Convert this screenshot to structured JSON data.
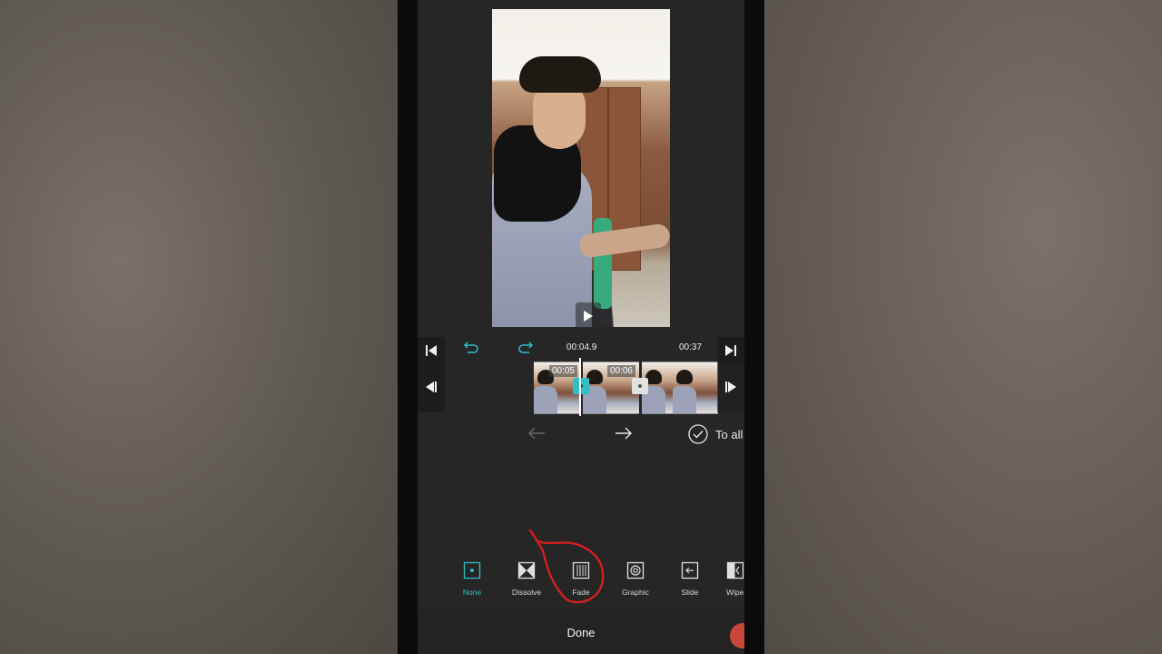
{
  "app": {
    "accent_color": "#2ec0c7",
    "background": "#262626"
  },
  "preview": {
    "play_icon": "play-icon"
  },
  "toolbar": {
    "current_time": "00:04.9",
    "total_time": "00:37",
    "undo_icon": "undo-icon",
    "redo_icon": "redo-icon",
    "skip_start_icon": "skip-to-start-icon",
    "skip_end_icon": "skip-to-end-icon"
  },
  "timeline": {
    "clips": [
      {
        "duration": "00:05"
      },
      {
        "duration": "00:06"
      },
      {
        "duration": ""
      }
    ]
  },
  "navigation": {
    "to_all_label": "To all"
  },
  "transitions": {
    "selected": "None",
    "items": [
      {
        "label": "None",
        "icon": "none-transition-icon"
      },
      {
        "label": "Dissolve",
        "icon": "dissolve-icon"
      },
      {
        "label": "Fade",
        "icon": "fade-icon"
      },
      {
        "label": "Graphic",
        "icon": "graphic-icon"
      },
      {
        "label": "Slide",
        "icon": "slide-icon"
      },
      {
        "label": "Wipe",
        "icon": "wipe-icon"
      }
    ]
  },
  "footer": {
    "done_label": "Done"
  },
  "annotation": {
    "color": "#d61f1f"
  }
}
